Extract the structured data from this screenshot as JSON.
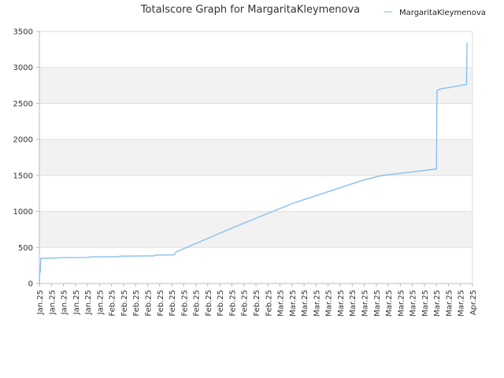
{
  "chart_data": {
    "type": "line",
    "title": "Totalscore Graph for MargaritaKleymenova",
    "xlabel": "",
    "ylabel": "",
    "ylim": [
      0,
      3500
    ],
    "yticks": [
      0,
      500,
      1000,
      1500,
      2000,
      2500,
      3000,
      3500
    ],
    "xtick_labels": [
      "Jan.25",
      "Jan.25",
      "Jan.25",
      "Jan.25",
      "Jan.25",
      "Jan.25",
      "Feb.25",
      "Feb.25",
      "Feb.25",
      "Feb.25",
      "Feb.25",
      "Feb.25",
      "Feb.25",
      "Feb.25",
      "Feb.25",
      "Feb.25",
      "Feb.25",
      "Feb.25",
      "Feb.25",
      "Feb.25",
      "Mar.25",
      "Mar.25",
      "Mar.25",
      "Mar.25",
      "Mar.25",
      "Mar.25",
      "Mar.25",
      "Mar.25",
      "Mar.25",
      "Mar.25",
      "Mar.25",
      "Mar.25",
      "Mar.25",
      "Mar.25",
      "Mar.25",
      "Mar.25",
      "Apr.25"
    ],
    "grid": true,
    "alternating_bands": true,
    "legend_position": "top-right",
    "colors": {
      "series": "#88c0ee",
      "band": "#f2f2f2",
      "grid": "#dddddd",
      "axis": "#bbbbbb"
    },
    "series": [
      {
        "name": "MargaritaKleymenova",
        "x": [
          0,
          0.03,
          0.08,
          0.12,
          0.5,
          1.5,
          2.0,
          4.0,
          4.2,
          6.5,
          6.7,
          9.5,
          9.7,
          11.0,
          11.2,
          11.3,
          11.4,
          16.0,
          21.0,
          27.0,
          28.5,
          33.0,
          33.05,
          33.1,
          33.3,
          35.0,
          35.2,
          35.5,
          35.55
        ],
        "y": [
          0,
          150,
          160,
          350,
          350,
          355,
          360,
          362,
          370,
          372,
          380,
          383,
          395,
          397,
          397,
          430,
          440,
          770,
          1110,
          1440,
          1500,
          1590,
          2680,
          2685,
          2700,
          2750,
          2760,
          2760,
          3340
        ]
      }
    ]
  }
}
